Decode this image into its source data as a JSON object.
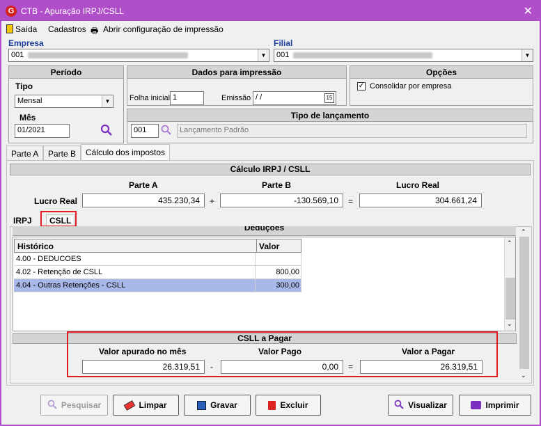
{
  "window": {
    "title": "CTB - Apuração IRPJ/CSLL",
    "app_icon": "G"
  },
  "menu": {
    "saida": "Saída",
    "cadastros": "Cadastros",
    "abrir_config": "Abrir configuração de impressão"
  },
  "empresa": {
    "label": "Empresa",
    "value": "001"
  },
  "filial": {
    "label": "Filial",
    "value": "001"
  },
  "periodo": {
    "header": "Período",
    "tipo_label": "Tipo",
    "tipo_value": "Mensal",
    "mes_label": "Mês",
    "mes_value": "01/2021"
  },
  "dados_impressao": {
    "header": "Dados para impressão",
    "folha_label": "Folha inicial",
    "folha_value": "1",
    "emissao_label": "Emissão",
    "emissao_value": "/ /",
    "calendar_num": "15"
  },
  "opcoes": {
    "header": "Opções",
    "consolidar_label": "Consolidar por empresa",
    "consolidar_checked": true
  },
  "tipo_lancamento": {
    "header": "Tipo de lançamento",
    "code": "001",
    "desc": "Lançamento Padrão"
  },
  "tabs": {
    "parte_a": "Parte A",
    "parte_b": "Parte B",
    "calculo": "Cálculo dos impostos"
  },
  "calculo": {
    "header": "Cálculo IRPJ / CSLL",
    "parte_a_label": "Parte A",
    "parte_b_label": "Parte B",
    "lucro_real_label": "Lucro Real",
    "lucro_real_col_label": "Lucro Real",
    "parte_a_value": "435.230,34",
    "parte_b_value": "-130.569,10",
    "lucro_real_value": "304.661,24",
    "plus": "+",
    "equals": "="
  },
  "subtabs": {
    "irpj": "IRPJ",
    "csll": "CSLL"
  },
  "deducoes": {
    "header": "Deduções",
    "col_historico": "Histórico",
    "col_valor": "Valor",
    "rows": [
      {
        "historico": "4.00 - DEDUCOES",
        "valor": ""
      },
      {
        "historico": "4.02 - Retenção de CSLL",
        "valor": "800,00"
      },
      {
        "historico": "4.04 - Outras Retenções - CSLL",
        "valor": "300,00"
      }
    ]
  },
  "csll_pagar": {
    "header": "CSLL a Pagar",
    "apurado_label": "Valor apurado no mês",
    "pago_label": "Valor Pago",
    "a_pagar_label": "Valor a Pagar",
    "apurado_value": "26.319,51",
    "pago_value": "0,00",
    "a_pagar_value": "26.319,51",
    "minus": "-",
    "equals": "="
  },
  "buttons": {
    "pesquisar": "Pesquisar",
    "limpar": "Limpar",
    "gravar": "Gravar",
    "excluir": "Excluir",
    "visualizar": "Visualizar",
    "imprimir": "Imprimir"
  },
  "colors": {
    "accent": "#b04fc9",
    "highlight_red": "#e01b24",
    "selected_row": "#a8b8e8",
    "label_blue": "#1a3e9a"
  }
}
